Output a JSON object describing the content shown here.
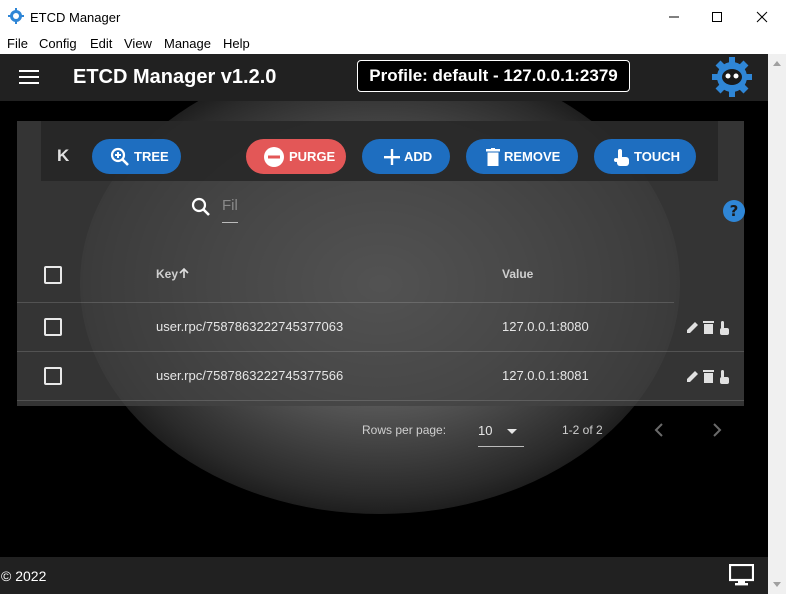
{
  "window": {
    "title": "ETCD Manager"
  },
  "menu": [
    "File",
    "Config",
    "Edit",
    "View",
    "Manage",
    "Help"
  ],
  "app": {
    "title": "ETCD Manager v1.2.0",
    "profile": "Profile: default - 127.0.0.1:2379"
  },
  "toolbar": {
    "k_label": "K",
    "tree_label": "TREE",
    "filter_placeholder": "Fil",
    "purge_label": "PURGE",
    "add_label": "ADD",
    "remove_label": "REMOVE",
    "touch_label": "TOUCH"
  },
  "table": {
    "headers": {
      "key": "Key",
      "value": "Value"
    },
    "rows": [
      {
        "key": "user.rpc/7587863222745377063",
        "value": "127.0.0.1:8080"
      },
      {
        "key": "user.rpc/7587863222745377566",
        "value": "127.0.0.1:8081"
      }
    ],
    "pagination": {
      "rows_per_page_label": "Rows per page:",
      "rows_per_page": "10",
      "range": "1-2 of 2"
    }
  },
  "footer": {
    "copyright": "© 2022"
  },
  "colors": {
    "accent": "#1e6ec0",
    "danger": "#e35757",
    "appbar": "#212121"
  },
  "icons": [
    "gear-logo-icon",
    "menu-icon",
    "zoom-in-icon",
    "search-icon",
    "minus-circle-icon",
    "plus-icon",
    "trash-icon",
    "touch-icon",
    "help-icon",
    "pencil-icon",
    "monitor-icon"
  ]
}
